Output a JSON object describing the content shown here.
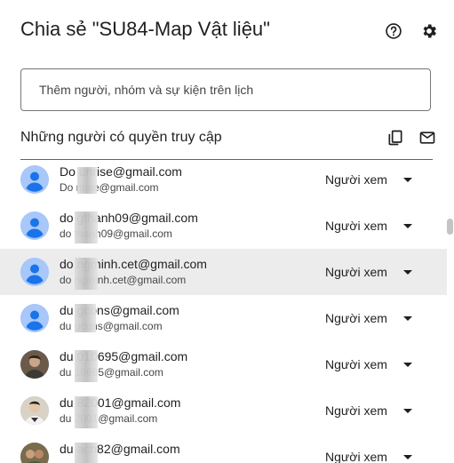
{
  "dialog": {
    "title": "Chia sẻ \"SU84-Map Vật liệu\"",
    "add_placeholder": "Thêm người, nhóm và sự kiện trên lịch",
    "section_title": "Những người có quyền truy cập"
  },
  "colors": {
    "avatar_default": "#a8c7fa",
    "row_highlight": "#ececec"
  },
  "people": [
    {
      "email": "Do      unrise@gmail.com",
      "sub": "Do      nrise@gmail.com",
      "role": "Người xem",
      "avatar": "default-avatar-icon"
    },
    {
      "email": "do      gthanh09@gmail.com",
      "sub": "do      thanh09@gmail.com",
      "role": "Người xem",
      "avatar": "default-avatar-icon"
    },
    {
      "email": "do      ngminh.cet@gmail.com",
      "sub": "do      ngminh.cet@gmail.com",
      "role": "Người xem",
      "avatar": "default-avatar-icon"
    },
    {
      "email": "du      gcons@gmail.com",
      "sub": "du      gcons@gmail.com",
      "role": "Người xem",
      "avatar": "default-avatar-icon"
    },
    {
      "email": "du      010695@gmail.com",
      "sub": "du      10695@gmail.com",
      "role": "Người xem",
      "avatar": "photo-avatar"
    },
    {
      "email": "du      82001@gmail.com",
      "sub": "du      2001@gmail.com",
      "role": "Người xem",
      "avatar": "photo-avatar"
    },
    {
      "email": "du      ach82@gmail.com",
      "sub": "",
      "role": "Người xem",
      "avatar": "photo-avatar"
    }
  ]
}
